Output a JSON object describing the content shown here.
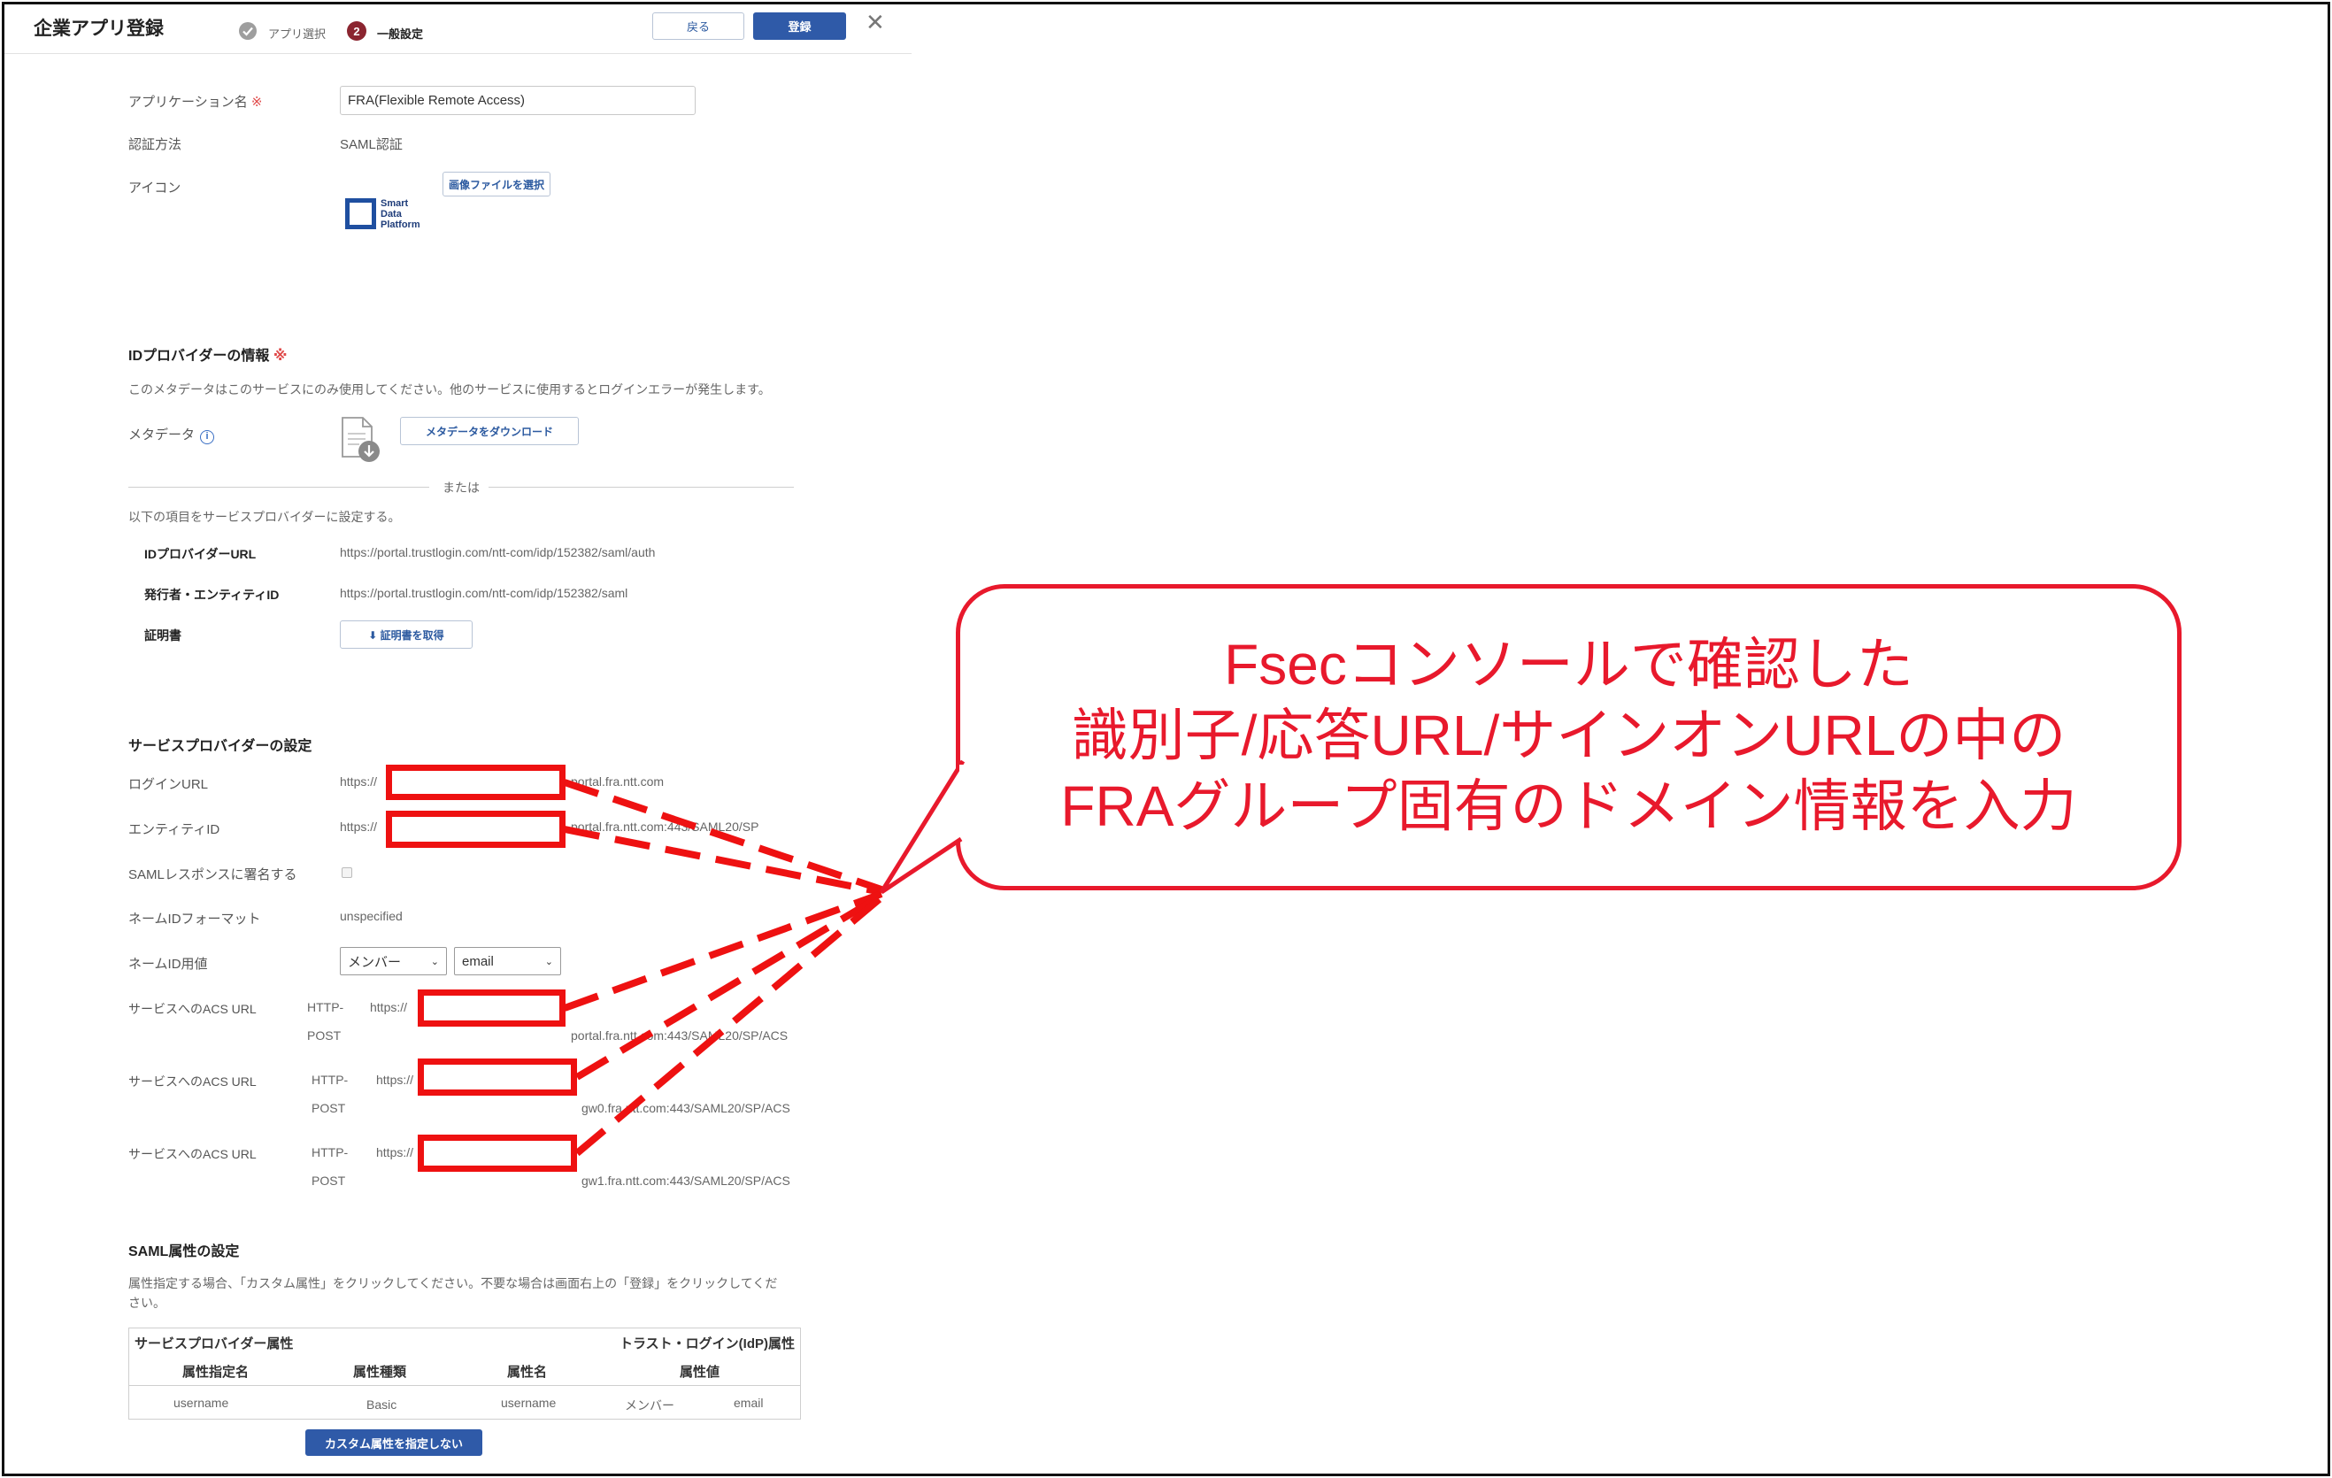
{
  "header": {
    "title": "企業アプリ登録",
    "step1_label": "アプリ選択",
    "step2_number": "2",
    "step2_label": "一般設定",
    "back_label": "戻る",
    "register_label": "登録",
    "close_glyph": "✕"
  },
  "general": {
    "app_name_label": "アプリケーション名",
    "required_mark": "※",
    "app_name_value": "FRA(Flexible Remote Access)",
    "auth_method_label": "認証方法",
    "auth_method_value": "SAML認証",
    "icon_label": "アイコン",
    "select_image_label": "画像ファイルを選択",
    "logo_text_1": "Smart",
    "logo_text_2": "Data",
    "logo_text_3": "Platform"
  },
  "idp": {
    "section_title": "IDプロバイダーの情報",
    "required_mark": "※",
    "description": "このメタデータはこのサービスにのみ使用してください。他のサービスに使用するとログインエラーが発生します。",
    "metadata_label": "メタデータ",
    "download_label": "メタデータをダウンロード",
    "or_label": "または",
    "configure_text": "以下の項目をサービスプロバイダーに設定する。",
    "idp_url_label": "IDプロバイダーURL",
    "idp_url_value": "https://portal.trustlogin.com/ntt-com/idp/152382/saml/auth",
    "issuer_label": "発行者・エンティティID",
    "issuer_value": "https://portal.trustlogin.com/ntt-com/idp/152382/saml",
    "cert_label": "証明書",
    "cert_button_label": "⬇ 証明書を取得"
  },
  "sp": {
    "section_title": "サービスプロバイダーの設定",
    "login_url_label": "ログインURL",
    "login_url_prefix": "https://",
    "login_url_suffix": "portal.fra.ntt.com",
    "entity_id_label": "エンティティID",
    "entity_id_prefix": "https://",
    "entity_id_suffix": "portal.fra.ntt.com:443/SAML20/SP",
    "sign_label": "SAMLレスポンスに署名する",
    "nameid_format_label": "ネームIDフォーマット",
    "nameid_format_value": "unspecified",
    "nameid_value_label": "ネームID用値",
    "nameid_select_1": "メンバー",
    "nameid_select_2": "email",
    "acs": [
      {
        "label": "サービスへのACS URL",
        "binding_1": "HTTP-",
        "binding_2": "POST",
        "prefix": "https://",
        "suffix": "portal.fra.ntt.com:443/SAML20/SP/ACS"
      },
      {
        "label": "サービスへのACS URL",
        "binding_1": "HTTP-",
        "binding_2": "POST",
        "prefix": "https://",
        "suffix": "gw0.fra.ntt.com:443/SAML20/SP/ACS"
      },
      {
        "label": "サービスへのACS URL",
        "binding_1": "HTTP-",
        "binding_2": "POST",
        "prefix": "https://",
        "suffix": "gw1.fra.ntt.com:443/SAML20/SP/ACS"
      }
    ]
  },
  "saml_attr": {
    "section_title": "SAML属性の設定",
    "description_1": "属性指定する場合、「カスタム属性」をクリックしてください。不要な場合は画面右上の「登録」をクリックしてくだ",
    "description_2": "さい。",
    "group_sp": "サービスプロバイダー属性",
    "group_idp": "トラスト・ログイン(IdP)属性",
    "columns": [
      "属性指定名",
      "属性種類",
      "属性名",
      "属性値"
    ],
    "row": [
      "username",
      "Basic",
      "username",
      "メンバー",
      "email"
    ],
    "no_custom_label": "カスタム属性を指定しない"
  },
  "callout": {
    "line1": "Fsecコンソールで確認した",
    "line2": "識別子/応答URL/サインオンURLの中の",
    "line3": "FRAグループ固有のドメイン情報を入力"
  },
  "colors": {
    "annotation_red": "#e8192c",
    "primary_blue": "#2f5aa8"
  }
}
